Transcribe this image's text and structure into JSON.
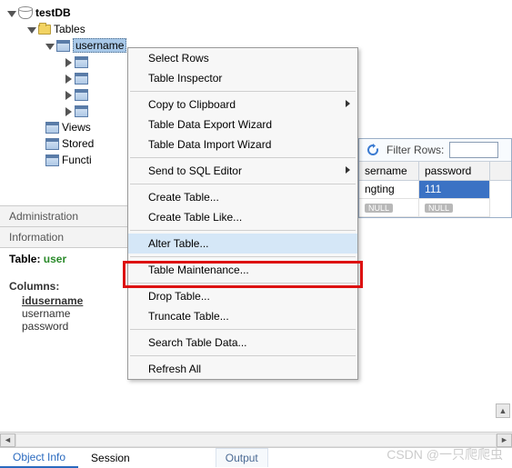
{
  "tree": {
    "db": "testDB",
    "tables_label": "Tables",
    "username_label": "username",
    "views": "Views",
    "stored": "Stored",
    "functi": "Functi"
  },
  "tabs": {
    "admin": "Administration",
    "info": "Information"
  },
  "info": {
    "table_prefix": "Table: ",
    "table_name": "user",
    "columns_label": "Columns:",
    "col1": "idusername",
    "col2": "username",
    "col3": "password"
  },
  "menu": {
    "select_rows": "Select Rows",
    "inspector": "Table Inspector",
    "copy": "Copy to Clipboard",
    "export": "Table Data Export Wizard",
    "import": "Table Data Import Wizard",
    "send": "Send to SQL Editor",
    "create": "Create Table...",
    "create_like": "Create Table Like...",
    "alter": "Alter Table...",
    "maint": "Table Maintenance...",
    "drop": "Drop Table...",
    "truncate": "Truncate Table...",
    "search": "Search Table Data...",
    "refresh": "Refresh All"
  },
  "grid": {
    "filter_label": "Filter Rows:",
    "col_user": "sername",
    "col_pass": "password",
    "row1_user": "ngting",
    "row1_pass": "111",
    "null": "NULL"
  },
  "bottom_tabs": {
    "object_info": "Object Info",
    "session": "Session",
    "output": "Output"
  },
  "watermark": "CSDN @一只爬爬虫"
}
